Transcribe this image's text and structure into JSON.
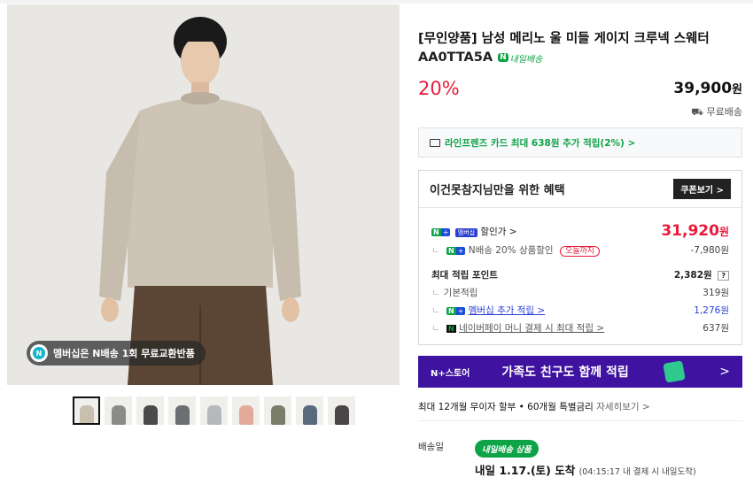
{
  "gallery": {
    "promo_text": "멤버십은 N배송 1회 무료교환반품",
    "thumb_colors": [
      "#c9bfae",
      "#8a8a88",
      "#4a4a4a",
      "#6b6e72",
      "#b5b9bb",
      "#e2aa9a",
      "#7a7d6a",
      "#5a6a7d",
      "#4a4547"
    ]
  },
  "product": {
    "title": "[무인양품] 남성 메리노 울 미들 게이지 크루넥 스웨터",
    "code": "AA0TTA5A",
    "badge_n": "N",
    "badge_text": "내일배송",
    "discount": "20%",
    "price": "39,900",
    "won": "원",
    "shipping": "무료배송",
    "card_promo": "라인프렌즈 카드 최대 638원 추가 적립(2%) >"
  },
  "benefit": {
    "header": "이건못참지님만을 위한 혜택",
    "coupon_button": "쿠폰보기 >",
    "member_badge": "멤버십",
    "sale_label": "할인가 >",
    "sale_price": "31,920",
    "n_sale_label": "N배송 20% 상품할인",
    "today_tag": "오늘까지",
    "n_sale_value": "-7,980원",
    "points_label": "최대 적립 포인트",
    "points_value": "2,382원",
    "q": "?",
    "base_label": "기본적립",
    "base_value": "319원",
    "member_label": "멤버십 추가 적립 >",
    "member_value": "1,276원",
    "pay_label": "네이버페이 머니 결제 시 최대 적립 >",
    "pay_value": "637원"
  },
  "banner": {
    "tag": "N+스토어",
    "text": "가족도 친구도 함께 적립",
    "arrow": ">"
  },
  "installment": {
    "main": "최대 12개월 무이자 할부 • 60개월 특별금리",
    "link": "자세히보기 >"
  },
  "delivery": {
    "label": "배송일",
    "tag": "내일배송 상품",
    "date": "내일 1.17.(토) 도착",
    "note": "(04:15:17 내 결제 시 내일도착)"
  }
}
